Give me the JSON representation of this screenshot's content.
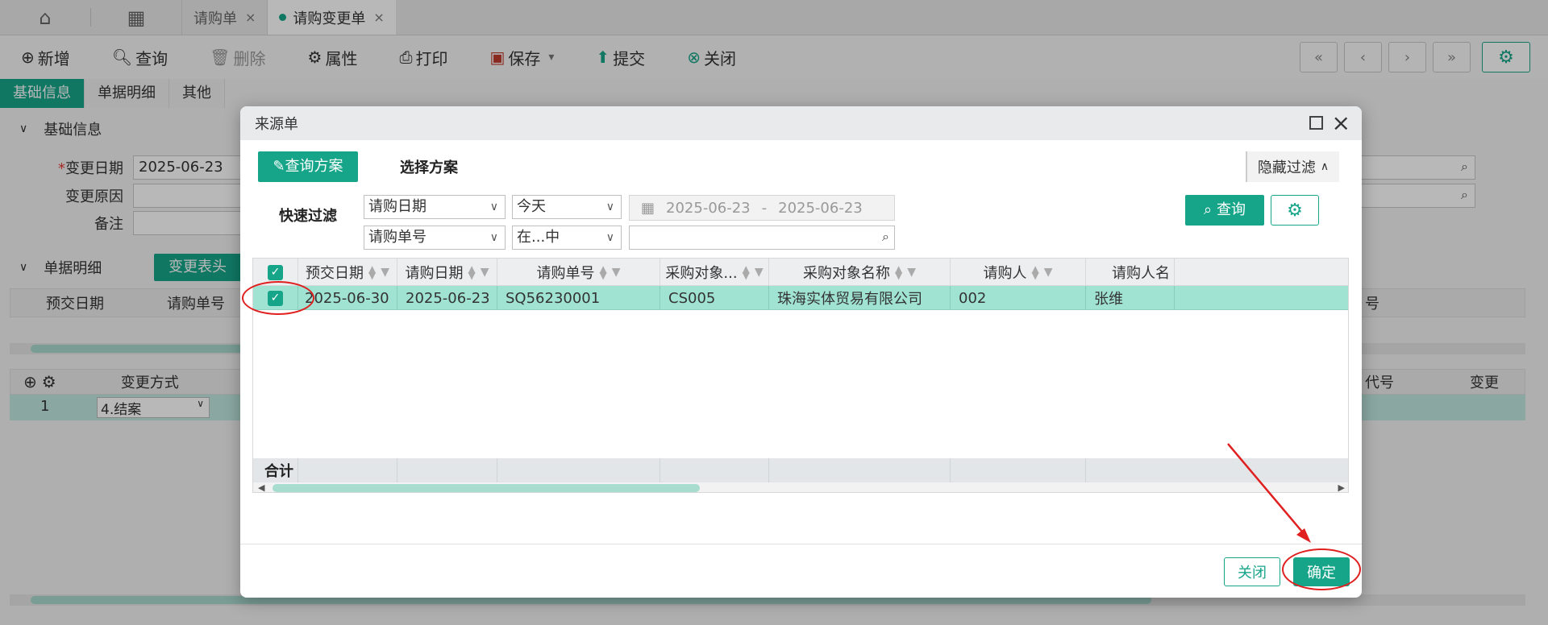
{
  "topbar": {
    "tabs": [
      {
        "label": "请购单",
        "close": "×"
      },
      {
        "label": "请购变更单",
        "close": "×"
      }
    ]
  },
  "toolbar": {
    "add": "新增",
    "query": "查询",
    "delete": "删除",
    "properties": "属性",
    "print": "打印",
    "save": "保存",
    "submit": "提交",
    "close": "关闭"
  },
  "nav": {
    "first": "«",
    "prev": "‹",
    "next": "›",
    "last": "»"
  },
  "subtabs": [
    "基础信息",
    "单据明细",
    "其他"
  ],
  "basic_section": {
    "title": "基础信息",
    "change_date_label": "变更日期",
    "change_date_value": "2025-06-23",
    "change_reason_label": "变更原因",
    "remark_label": "备注"
  },
  "detail_section": {
    "title": "单据明细",
    "change_header_btn": "变更表头",
    "grid_headers": [
      "预交日期",
      "请购单号",
      "号"
    ],
    "lower_headers": [
      "变更方式",
      "代号",
      "变更"
    ],
    "row_no": "1",
    "change_mode": "4.结案"
  },
  "dialog": {
    "title": "来源单",
    "scheme_btn": "查询方案",
    "scheme_label": "选择方案",
    "hide_filter": "隐藏过滤",
    "quick_filter_label": "快速过滤",
    "filter1_field": "请购日期",
    "filter1_op": "今天",
    "date_from": "2025-06-23",
    "date_sep": "-",
    "date_to": "2025-06-23",
    "filter2_field": "请购单号",
    "filter2_op": "在...中",
    "search_value": "",
    "query_btn": "查询",
    "columns": [
      "预交日期",
      "请购日期",
      "请购单号",
      "采购对象...",
      "采购对象名称",
      "请购人",
      "请购人名"
    ],
    "rows": [
      {
        "cells": [
          "2025-06-30",
          "2025-06-23",
          "SQ56230001",
          "CS005",
          "珠海实体贸易有限公司",
          "002",
          "张维"
        ]
      }
    ],
    "total_label": "合计",
    "cancel_btn": "关闭",
    "ok_btn": "确定"
  },
  "colors": {
    "accent": "#17a589",
    "row_selected": "#a0e3d3",
    "annotation": "#e02020"
  }
}
